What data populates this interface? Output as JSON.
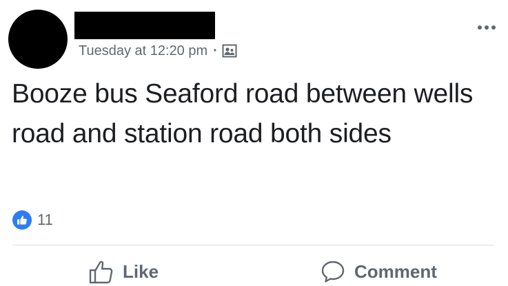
{
  "post": {
    "author_name": "",
    "timestamp": "Tuesday at 12:20 pm",
    "separator": "·",
    "audience_icon": "group-audience-icon",
    "text": "Booze bus Seaford road between wells road and station road both sides",
    "more_icon": "more-options-icon"
  },
  "reactions": {
    "icon": "like-reaction-icon",
    "count": "11"
  },
  "actions": {
    "like_label": "Like",
    "comment_label": "Comment"
  },
  "colors": {
    "text": "#1c1e21",
    "secondary": "#606770",
    "like_blue": "#2e7cf6",
    "divider": "#dadde1"
  }
}
